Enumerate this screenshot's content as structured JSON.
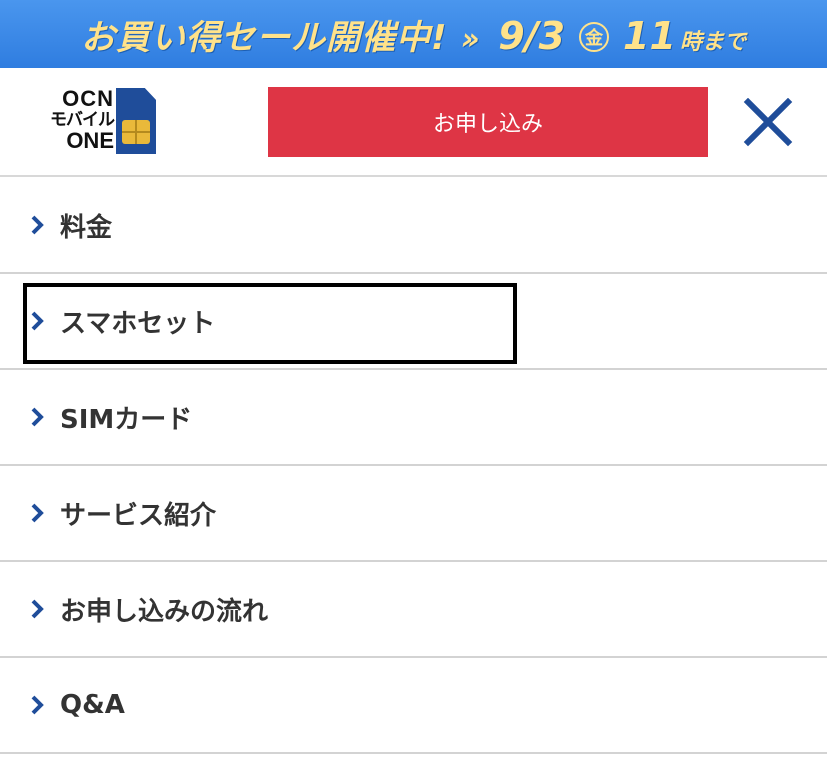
{
  "banner": {
    "title": "お買い得セール開催中!",
    "arrow": "››",
    "date": "9/3",
    "day_of_week": "金",
    "time": "11",
    "until": "時まで",
    "colors": {
      "background": "#3a8ae6",
      "text": "#ffe28a"
    }
  },
  "header": {
    "logo": {
      "line1": "OCN",
      "line2": "モバイル",
      "line3": "ONE"
    },
    "apply_label": "お申し込み",
    "close_icon": "close-x-icon",
    "colors": {
      "apply_bg": "#de3545",
      "close": "#1f4d9a"
    }
  },
  "menu": {
    "items": [
      {
        "label": "料金"
      },
      {
        "label": "スマホセット",
        "highlighted": true
      },
      {
        "label": "SIMカード"
      },
      {
        "label": "サービス紹介"
      },
      {
        "label": "お申し込みの流れ"
      },
      {
        "label": "Q&A"
      }
    ],
    "chevron_icon": "chevron-right-icon",
    "colors": {
      "chevron": "#1f4d9a",
      "divider": "#d3d3d3"
    }
  }
}
